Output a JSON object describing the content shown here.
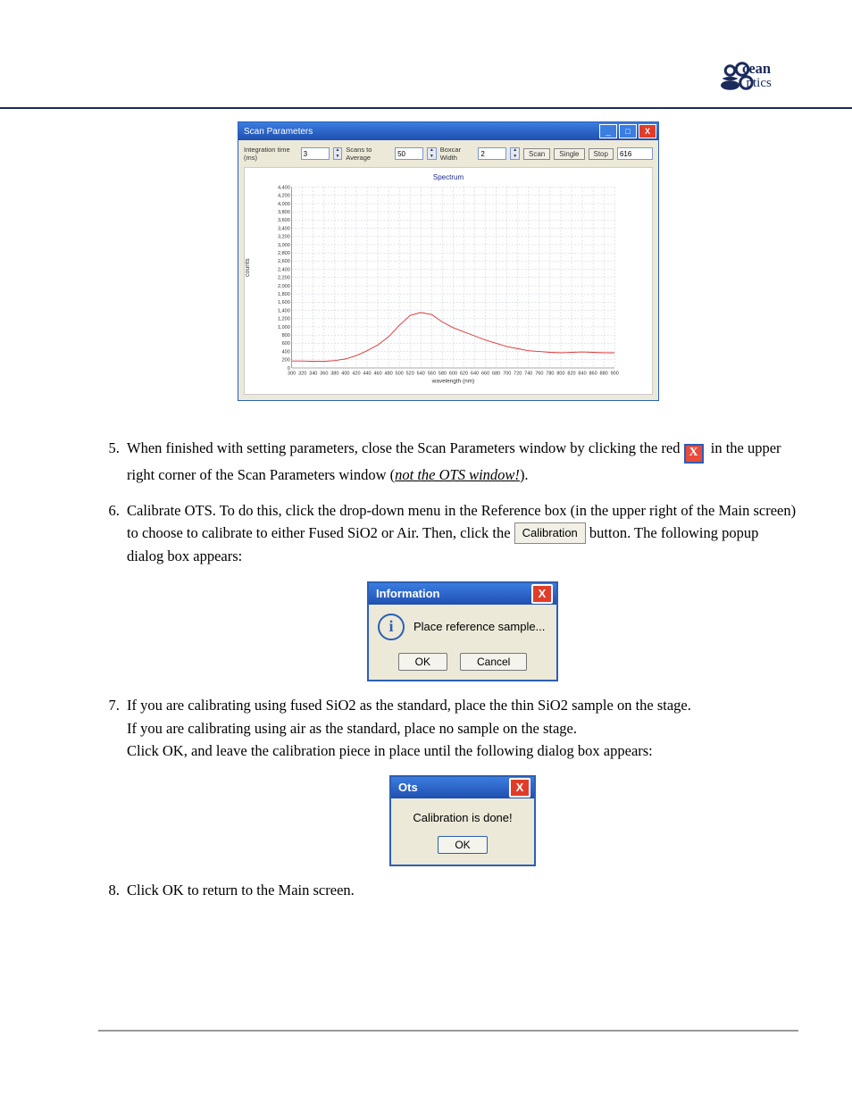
{
  "logo": {
    "l1": "cean",
    "l2": "ptics"
  },
  "scan_window": {
    "title": "Scan Parameters",
    "integration_label": "Integration time (ms)",
    "integration_value": "3",
    "scans_avg_label": "Scans to Average",
    "scans_avg_value": "50",
    "boxcar_label": "Boxcar Width",
    "boxcar_value": "2",
    "btn_scan": "Scan",
    "btn_single": "Single",
    "btn_stop": "Stop",
    "counter": "616",
    "plot_title": "Spectrum",
    "ylabel": "counts",
    "xlabel": "wavelength (nm)"
  },
  "chart_data": {
    "type": "line",
    "title": "Spectrum",
    "xlabel": "wavelength (nm)",
    "ylabel": "counts",
    "xlim": [
      300,
      900
    ],
    "ylim": [
      0,
      4400
    ],
    "xticks": [
      300,
      320,
      340,
      360,
      380,
      400,
      420,
      440,
      460,
      480,
      500,
      520,
      540,
      560,
      580,
      600,
      620,
      640,
      660,
      680,
      700,
      720,
      740,
      760,
      780,
      800,
      820,
      840,
      860,
      880,
      900
    ],
    "yticks": [
      0,
      200,
      400,
      600,
      800,
      1000,
      1200,
      1400,
      1600,
      1800,
      2000,
      2200,
      2400,
      2600,
      2800,
      3000,
      3200,
      3400,
      3600,
      3800,
      4000,
      4200,
      4400
    ],
    "series": [
      {
        "name": "spectrum",
        "color": "#d33",
        "x": [
          300,
          320,
          340,
          360,
          380,
          400,
          420,
          440,
          460,
          480,
          500,
          520,
          540,
          560,
          580,
          600,
          620,
          640,
          660,
          680,
          700,
          720,
          740,
          760,
          780,
          800,
          820,
          840,
          860,
          880,
          900
        ],
        "y": [
          170,
          170,
          160,
          160,
          180,
          220,
          300,
          420,
          560,
          760,
          1040,
          1280,
          1350,
          1300,
          1120,
          980,
          880,
          780,
          680,
          600,
          520,
          470,
          420,
          400,
          380,
          370,
          380,
          390,
          380,
          370,
          370
        ]
      }
    ]
  },
  "step5": {
    "a": "When finished with setting parameters, close the Scan Parameters window by clicking the red ",
    "b": " in the upper right corner of the Scan Parameters window (",
    "c": "not the OTS window!",
    "d": ")."
  },
  "step6": {
    "a": "Calibrate OTS. To do this, click the drop-down menu in the Reference box (in the upper right of the Main screen) to choose to calibrate to either Fused SiO2 or Air.  Then, click the ",
    "btn": "Calibration",
    "b": " button.  The following popup dialog box appears:"
  },
  "info_dialog": {
    "title": "Information",
    "msg": "Place reference sample...",
    "ok": "OK",
    "cancel": "Cancel"
  },
  "step7": {
    "a": "If you are calibrating using fused SiO2 as the standard, place the thin SiO2 sample on the stage.",
    "b": "If you are calibrating using air as the standard, place no sample on the stage.",
    "c": "Click OK, and leave the calibration piece in place until the following dialog box appears:"
  },
  "ots_dialog": {
    "title": "Ots",
    "msg": "Calibration is done!",
    "ok": "OK"
  },
  "step8": "Click OK to return to the Main screen."
}
